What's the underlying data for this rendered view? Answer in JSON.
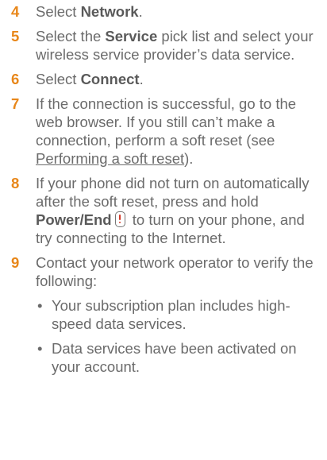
{
  "steps": [
    {
      "num": "4",
      "pre": "Select ",
      "bold": "Network",
      "post": "."
    },
    {
      "num": "5",
      "pre": "Select the ",
      "bold": "Service",
      "post": " pick list and select your wireless service provider’s data service."
    },
    {
      "num": "6",
      "pre": "Select ",
      "bold": "Connect",
      "post": "."
    },
    {
      "num": "7",
      "pre": "If the connection is successful, go to the web browser. If you still can’t make a connection, perform a soft reset (see ",
      "link": "Performing a soft reset",
      "post": ")."
    },
    {
      "num": "8",
      "pre": "If your phone did not turn on automatically after the soft reset, press and hold ",
      "bold": "Power/End",
      "icon": "power-end-key-icon",
      "post": " to turn on your phone, and try connecting to the Internet."
    },
    {
      "num": "9",
      "pre": "Contact your network operator to verify the following:"
    }
  ],
  "bullets": [
    "Your subscription plan includes high-speed data services.",
    "Data services have been activated on your account."
  ],
  "colors": {
    "step_number": "#e8871a",
    "body_text": "#6b6b6b",
    "icon_accent": "#d23a2a"
  }
}
